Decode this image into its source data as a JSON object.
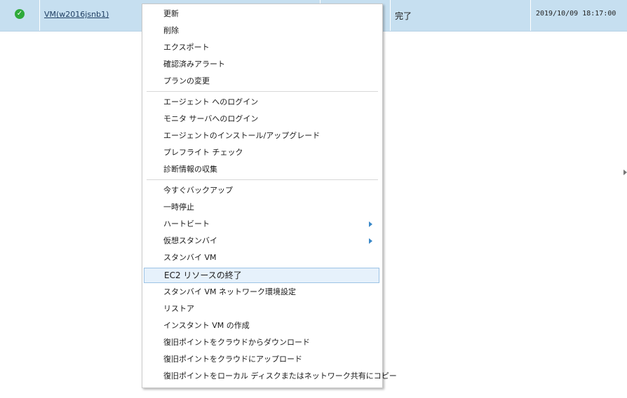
{
  "job_row": {
    "status_icon": "checkmark-circle-icon",
    "vm_name": "VM(w2016jsnb1)",
    "job_status": "完了",
    "timestamp": "2019/10/09 18:17:00"
  },
  "context_menu": {
    "group1": [
      "更新",
      "削除",
      "エクスポート",
      "確認済みアラート",
      "プランの変更"
    ],
    "group2": [
      "エージェント へのログイン",
      "モニタ サーバへのログイン",
      "エージェントのインストール/アップグレード",
      "プレフライト チェック",
      "診断情報の収集"
    ],
    "group3": [
      "今すぐバックアップ",
      "一時停止",
      "ハートビート",
      "仮想スタンバイ",
      "スタンバイ VM",
      "EC2 リソースの終了",
      "スタンバイ VM ネットワーク環境設定",
      "リストア",
      "インスタント VM の作成",
      "復旧ポイントをクラウドからダウンロード",
      "復旧ポイントをクラウドにアップロード",
      "復旧ポイントをローカル ディスクまたはネットワーク共有にコピー"
    ]
  },
  "colors": {
    "selected_row": "#c6dff0",
    "hover_item": "#e6f1fb",
    "success": "#2eaa3a"
  }
}
